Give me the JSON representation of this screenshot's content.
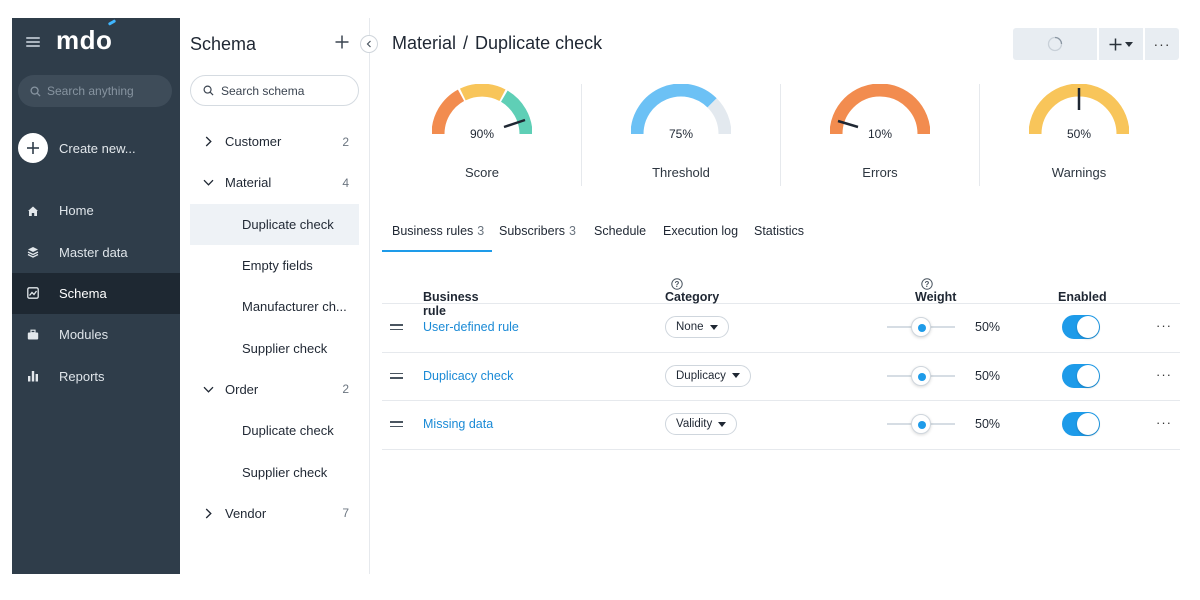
{
  "nav": {
    "logo": "mdo",
    "search_placeholder": "Search anything",
    "create_label": "Create new...",
    "items": [
      {
        "label": "Home",
        "icon": "home-icon",
        "active": false
      },
      {
        "label": "Master data",
        "icon": "layers-icon",
        "active": false
      },
      {
        "label": "Schema",
        "icon": "schema-icon",
        "active": true
      },
      {
        "label": "Modules",
        "icon": "briefcase-icon",
        "active": false
      },
      {
        "label": "Reports",
        "icon": "bar-chart-icon",
        "active": false
      }
    ]
  },
  "schema": {
    "title": "Schema",
    "search_placeholder": "Search schema",
    "tree": [
      {
        "label": "Customer",
        "count": "2",
        "expanded": false,
        "children": []
      },
      {
        "label": "Material",
        "count": "4",
        "expanded": true,
        "children": [
          "Duplicate check",
          "Empty fields",
          "Manufacturer ch...",
          "Supplier check"
        ]
      },
      {
        "label": "Order",
        "count": "2",
        "expanded": true,
        "children": [
          "Duplicate check",
          "Supplier check"
        ]
      },
      {
        "label": "Vendor",
        "count": "7",
        "expanded": false,
        "children": []
      }
    ],
    "selected": "Material/Duplicate check"
  },
  "breadcrumb": {
    "parent": "Material",
    "separator": "/",
    "current": "Duplicate check"
  },
  "gauges": [
    {
      "label": "Score",
      "value_text": "90%",
      "value": 90
    },
    {
      "label": "Threshold",
      "value_text": "75%",
      "value": 75
    },
    {
      "label": "Errors",
      "value_text": "10%",
      "value": 10
    },
    {
      "label": "Warnings",
      "value_text": "50%",
      "value": 50
    }
  ],
  "tabs": [
    {
      "label": "Business rules",
      "count": "3",
      "active": true
    },
    {
      "label": "Subscribers",
      "count": "3",
      "active": false
    },
    {
      "label": "Schedule",
      "count": "",
      "active": false
    },
    {
      "label": "Execution log",
      "count": "",
      "active": false
    },
    {
      "label": "Statistics",
      "count": "",
      "active": false
    }
  ],
  "table": {
    "headers": {
      "rule": "Business rule",
      "category": "Category",
      "weight": "Weight",
      "enabled": "Enabled"
    },
    "rows": [
      {
        "rule": "User-defined rule",
        "category": "None",
        "weight": 50,
        "weight_text": "50%",
        "enabled": true
      },
      {
        "rule": "Duplicacy check",
        "category": "Duplicacy",
        "weight": 50,
        "weight_text": "50%",
        "enabled": true
      },
      {
        "rule": "Missing data",
        "category": "Validity",
        "weight": 50,
        "weight_text": "50%",
        "enabled": true
      }
    ]
  },
  "colors": {
    "nav_bg": "#2f3d4a",
    "accent": "#1e9be9",
    "link": "#1a8ad6",
    "gauge_orange": "#f28c4f",
    "gauge_yellow": "#f8c55a",
    "gauge_teal": "#5fcfb6",
    "gauge_blue": "#6cc1f5"
  }
}
